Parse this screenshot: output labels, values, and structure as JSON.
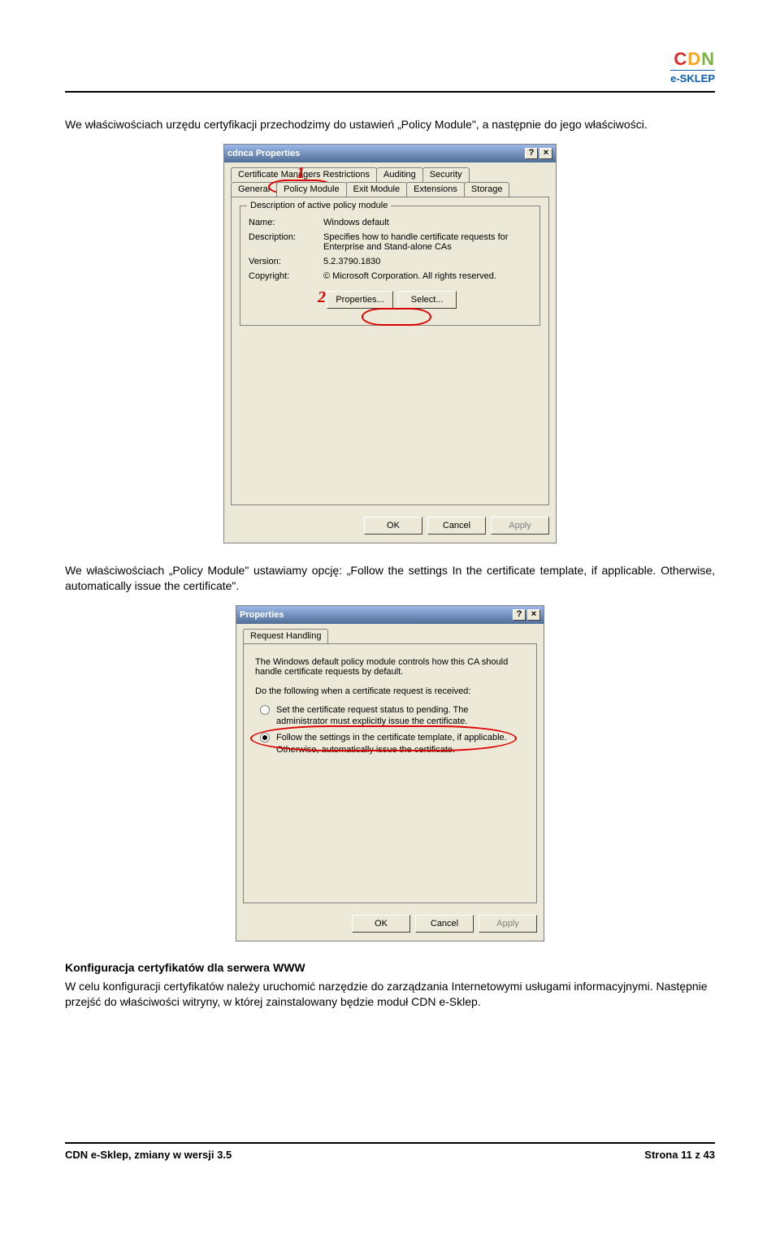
{
  "logo": {
    "letters": [
      "C",
      "D",
      "N"
    ],
    "sub": "e-SKLEP"
  },
  "para1": "We właściwościach urzędu certyfikacji przechodzimy do ustawień „Policy Module\", a następnie do jego właściwości.",
  "para2": "We właściwościach „Policy Module\" ustawiamy opcję: „Follow the settings In the certificate template, if applicable. Otherwise, automatically issue the certificate\".",
  "dlg1": {
    "title": "cdnca Properties",
    "tabs_top": [
      "Certificate Managers Restrictions",
      "Auditing",
      "Security"
    ],
    "tabs_bot": [
      "General",
      "Policy Module",
      "Exit Module",
      "Extensions",
      "Storage"
    ],
    "active_tab": "Policy Module",
    "group_title": "Description of active policy module",
    "fields": {
      "name_label": "Name:",
      "name_value": "Windows default",
      "desc_label": "Description:",
      "desc_value": "Specifies how to handle certificate requests for Enterprise and Stand-alone CAs",
      "ver_label": "Version:",
      "ver_value": "5.2.3790.1830",
      "copy_label": "Copyright:",
      "copy_value": "© Microsoft Corporation. All rights reserved."
    },
    "btn_properties": "Properties...",
    "btn_select": "Select...",
    "btn_ok": "OK",
    "btn_cancel": "Cancel",
    "btn_apply": "Apply",
    "annot": {
      "num1": "1",
      "num2": "2"
    }
  },
  "dlg2": {
    "title": "Properties",
    "tab": "Request Handling",
    "intro1": "The Windows default policy module controls how this CA should handle certificate requests by default.",
    "intro2": "Do the following when a certificate request is received:",
    "opt1": "Set the certificate request status to pending. The administrator must explicitly issue the certificate.",
    "opt2": "Follow the settings in the certificate template, if applicable. Otherwise, automatically issue the certificate.",
    "btn_ok": "OK",
    "btn_cancel": "Cancel",
    "btn_apply": "Apply"
  },
  "section_heading": "Konfiguracja certyfikatów dla serwera WWW",
  "para3": "W celu konfiguracji certyfikatów należy uruchomić narzędzie do zarządzania Internetowymi usługami informacyjnymi. Następnie przejść do właściwości witryny, w której zainstalowany będzie moduł CDN e-Sklep.",
  "footer_left": "CDN e-Sklep, zmiany w wersji 3.5",
  "footer_right": "Strona 11 z 43"
}
